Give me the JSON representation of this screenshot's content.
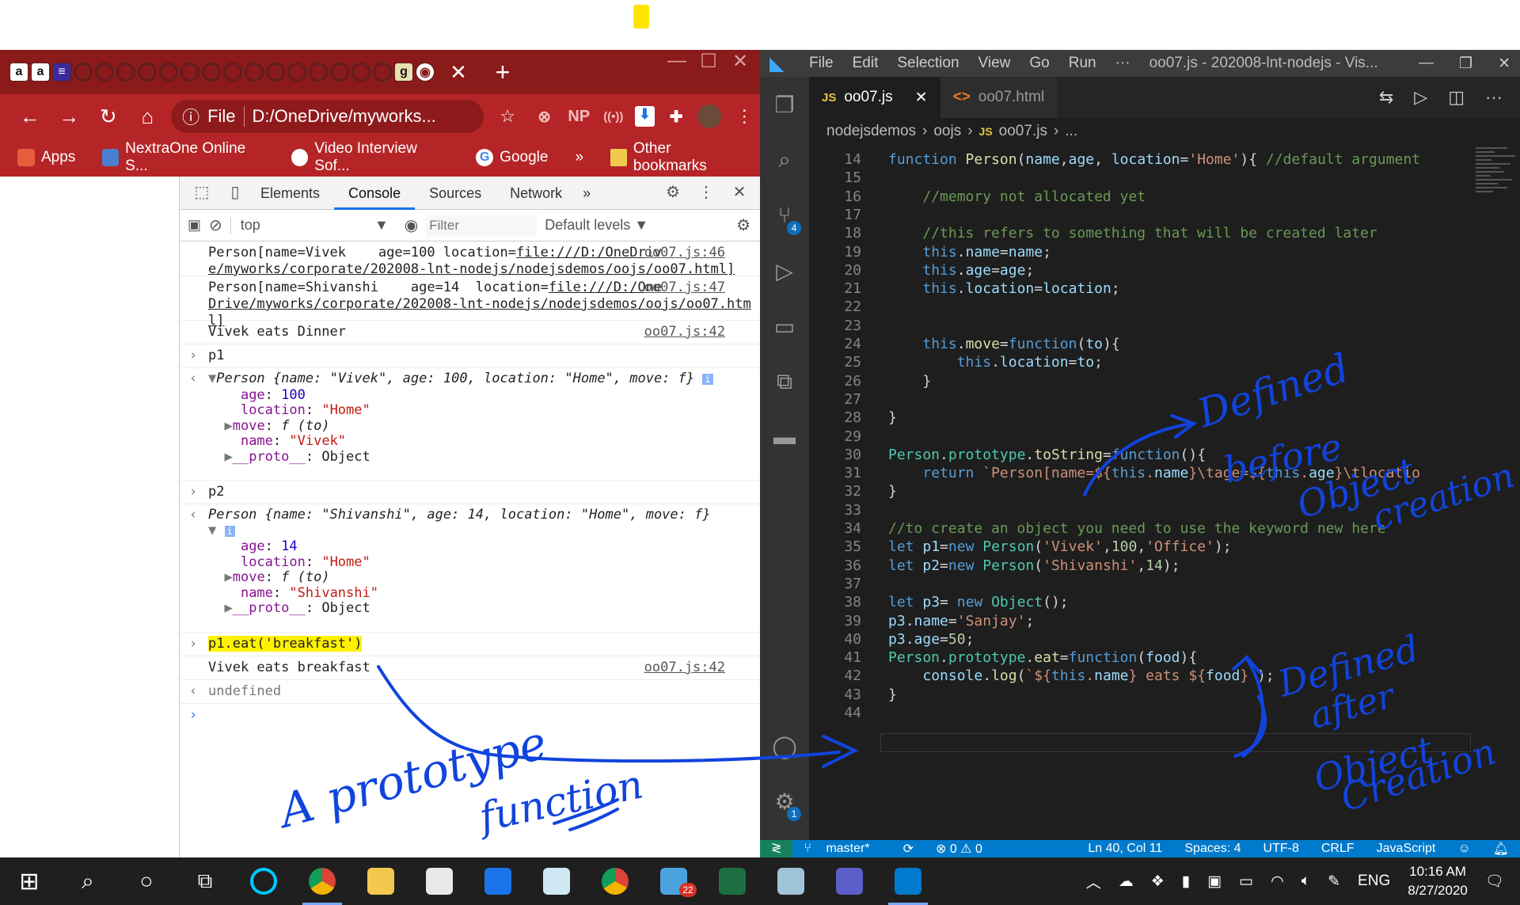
{
  "chrome": {
    "tab_close": "✕",
    "tab_new": "+",
    "address_file_label": "File",
    "address_text": "D:/OneDrive/myworks...",
    "ext_np": "NP",
    "bookmarks": [
      "Apps",
      "NextraOne Online S...",
      "Video Interview Sof...",
      "Google",
      "»",
      "Other bookmarks"
    ]
  },
  "devtools": {
    "tabs": [
      "Elements",
      "Console",
      "Sources",
      "Network",
      "»"
    ],
    "context": "top",
    "filter_placeholder": "Filter",
    "levels": "Default levels ▼",
    "log1_a": "Person[name=Vivek    age=100 location=",
    "log1_link": "file:///D:/OneDriv",
    "log1_b": "e/myworks/corporate/202008-lnt-nodejs/nodejsdemos/oojs/oo07.html]",
    "log1_src": "oo07.js:46",
    "log2_a": "Person[name=Shivanshi    age=14  location=",
    "log2_link": "file:///D:/One",
    "log2_b": "Drive/myworks/corporate/202008-lnt-nodejs/nodejsdemos/oojs/oo07.htm",
    "log2_c": "l]",
    "log2_src": "oo07.js:47",
    "log3": "Vivek eats Dinner",
    "log3_src": "oo07.js:42",
    "in_p1": "p1",
    "p1_summary_name": "Person",
    "p1_summary": "{name: \"Vivek\", age: 100, location: \"Home\", move: f}",
    "p1_age": "100",
    "p1_location": "\"Home\"",
    "p1_move": "f (to)",
    "p1_name": "\"Vivek\"",
    "proto": "__proto__",
    "proto_val": "Object",
    "in_p2": "p2",
    "p2_summary_name": "Person",
    "p2_summary": "{name: \"Shivanshi\", age: 14, location: \"Home\", move: f}",
    "p2_age": "14",
    "p2_location": "\"Home\"",
    "p2_move": "f (to)",
    "p2_name": "\"Shivanshi\"",
    "in_eat": "p1.eat('breakfast')",
    "out_eat": "Vivek eats breakfast",
    "out_eat_src": "oo07.js:42",
    "undefined": "undefined",
    "prompt": "›"
  },
  "vscode": {
    "menu": [
      "File",
      "Edit",
      "Selection",
      "View",
      "Go",
      "Run",
      "···"
    ],
    "title": "oo07.js - 202008-lnt-nodejs - Vis...",
    "tab_js": "oo07.js",
    "tab_html": "oo07.html",
    "breadcrumb": [
      "nodejsdemos",
      "oojs",
      "oo07.js",
      "..."
    ],
    "scm_badge": "4",
    "settings_badge": "1",
    "line_numbers": [
      "14",
      "15",
      "16",
      "17",
      "18",
      "19",
      "20",
      "21",
      "22",
      "23",
      "24",
      "25",
      "26",
      "27",
      "28",
      "29",
      "30",
      "31",
      "32",
      "33",
      "34",
      "35",
      "36",
      "37",
      "38",
      "39",
      "40",
      "41",
      "42",
      "43",
      "44"
    ],
    "status": {
      "branch": "master*",
      "problems": "⊗ 0 ⚠ 0",
      "position": "Ln 40, Col 11",
      "spaces": "Spaces: 4",
      "encoding": "UTF-8",
      "eol": "CRLF",
      "language": "JavaScript"
    }
  },
  "annotations": {
    "defined_before": [
      "Defined",
      "before",
      "Object",
      "creation"
    ],
    "defined_after": [
      "Defined",
      "after",
      "Object",
      "Creation"
    ],
    "prototype_fn": [
      "A prototype",
      "function"
    ]
  },
  "taskbar": {
    "mail_badge": "22",
    "lang": "ENG",
    "time": "10:16 AM",
    "date": "8/27/2020"
  }
}
